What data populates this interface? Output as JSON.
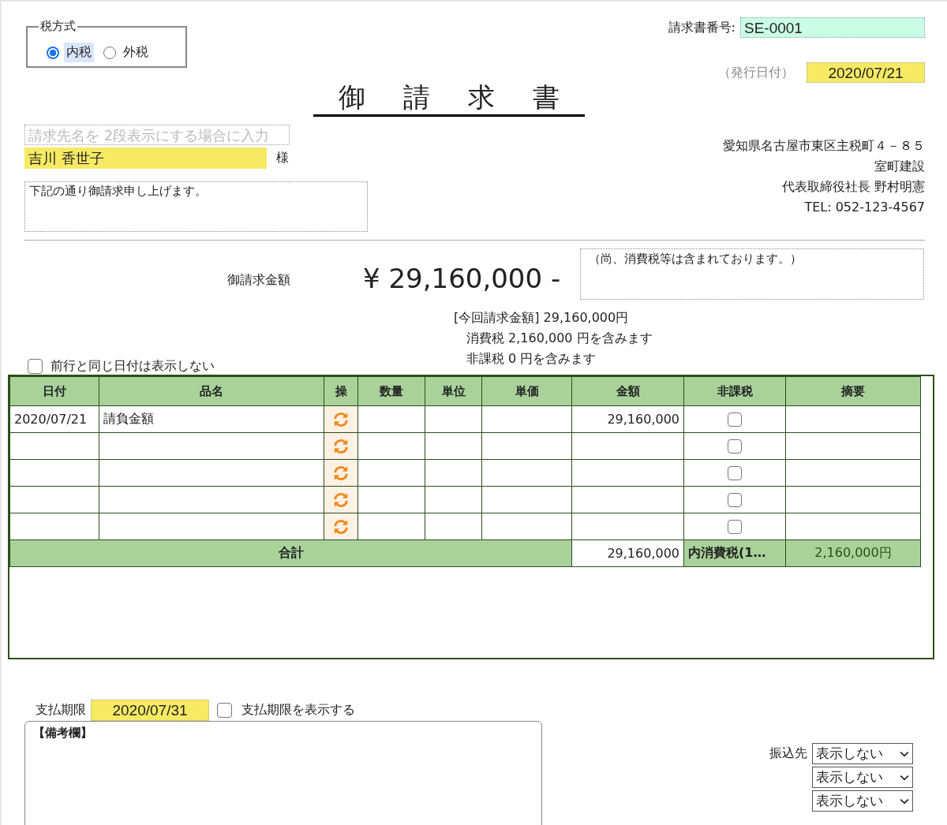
{
  "tax_mode": {
    "legend": "税方式",
    "options": [
      {
        "label": "内税",
        "selected": true
      },
      {
        "label": "外税",
        "selected": false
      }
    ]
  },
  "invoice_number": {
    "label": "請求書番号:",
    "value": "SE-0001"
  },
  "issue_date": {
    "label": "（発行日付）",
    "value": "2020/07/21"
  },
  "title": "御 請 求 書",
  "recipient": {
    "line1_placeholder": "請求先名を 2段表示にする場合に入力",
    "name": "吉川 香世子",
    "honorific": "様",
    "message": "下記の通り御請求申し上げます。"
  },
  "issuer": [
    "愛知県名古屋市東区主税町４－８５",
    "室町建設",
    "代表取締役社長 野村明憲",
    "TEL: 052-123-4567"
  ],
  "amount": {
    "label": "御請求金額",
    "value": "¥ 29,160,000 -",
    "note": "（尚、消費税等は含まれております。）"
  },
  "breakdown": [
    "[今回請求金額] 29,160,000円",
    "消費税 2,160,000 円を含みます",
    "非課税 0 円を含みます"
  ],
  "hide_same_date": {
    "label": "前行と同じ日付は表示しない",
    "checked": false
  },
  "table": {
    "columns": [
      "日付",
      "品名",
      "操",
      "数量",
      "単位",
      "単価",
      "金額",
      "非課税",
      "摘要"
    ],
    "rows": [
      {
        "date": "2020/07/21",
        "item": "請負金額",
        "amount": "29,160,000",
        "tax_exempt": false
      },
      {
        "tax_exempt": false
      },
      {
        "tax_exempt": false
      },
      {
        "tax_exempt": false
      },
      {
        "tax_exempt": false
      }
    ],
    "total": {
      "label": "合計",
      "amount": "29,160,000",
      "tax_label": "内消費税(1…",
      "tax_value": "2,160,000円"
    }
  },
  "payment_due": {
    "label": "支払期限",
    "value": "2020/07/31",
    "show": {
      "label": "支払期限を表示する",
      "checked": false
    }
  },
  "remarks": {
    "label": "【備考欄】"
  },
  "bank": {
    "label": "振込先",
    "selects": [
      "表示しない",
      "表示しない",
      "表示しない"
    ]
  }
}
